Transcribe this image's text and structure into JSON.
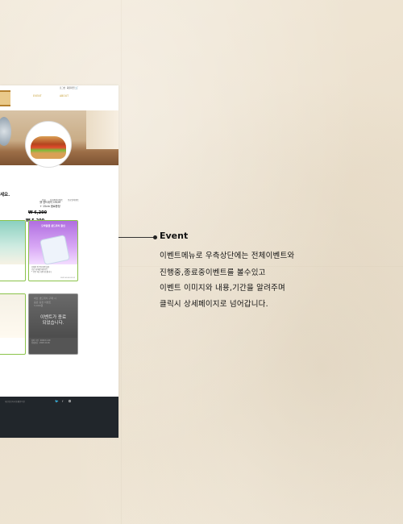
{
  "nav": {
    "links": [
      "EVENT",
      "ABOUT"
    ],
    "utility": [
      "로그인",
      "회원가입"
    ]
  },
  "banner": {
    "promo": [
      "쉘 샌드위치 15CM",
      "+ 15cm 음료증정"
    ],
    "old_price": "₩ 6,200",
    "new_price": "₩ 5,200"
  },
  "event_section": {
    "title": "세요.",
    "tabs": [
      "전체",
      "진행중인이벤트",
      "종료된이벤트"
    ],
    "cards": [
      {
        "headline": "",
        "desc": [],
        "date": ""
      },
      {
        "headline": "모바일앱 샌드위치 할인",
        "desc": [
          "모바일 앱 주문하면 할인",
          "기간 내 매장 이용가능",
          "* 쿠폰 1회 사용가능합니다"
        ],
        "date": "2021.03.02-03.31"
      },
      {
        "headline": "",
        "desc": [],
        "date": ""
      },
      {
        "headline": "",
        "ended_text": [
          "이벤트가 종료",
          "되었습니다."
        ],
        "faint": [
          "써브 샌드위치 구매 시",
          "음료 증정 이벤트",
          "3,000원"
        ],
        "desc": [
          "참여 기간 : 2020.11.20",
          "당첨발표 : 2020.11.26"
        ],
        "date": ""
      }
    ]
  },
  "footer": {
    "links": [
      "개인정보처리방침",
      "이용약관"
    ],
    "lines": [
      "",
      ""
    ]
  },
  "annotation": {
    "title": "Event",
    "lines": [
      "이벤트메뉴로 우측상단에는 전체이벤트와",
      "진행중,종료중이벤트를 볼수있고",
      "이벤트 이미지와 내용,기간을 알려주며",
      "클릭시 상세페이지로 넘어갑니다."
    ]
  }
}
